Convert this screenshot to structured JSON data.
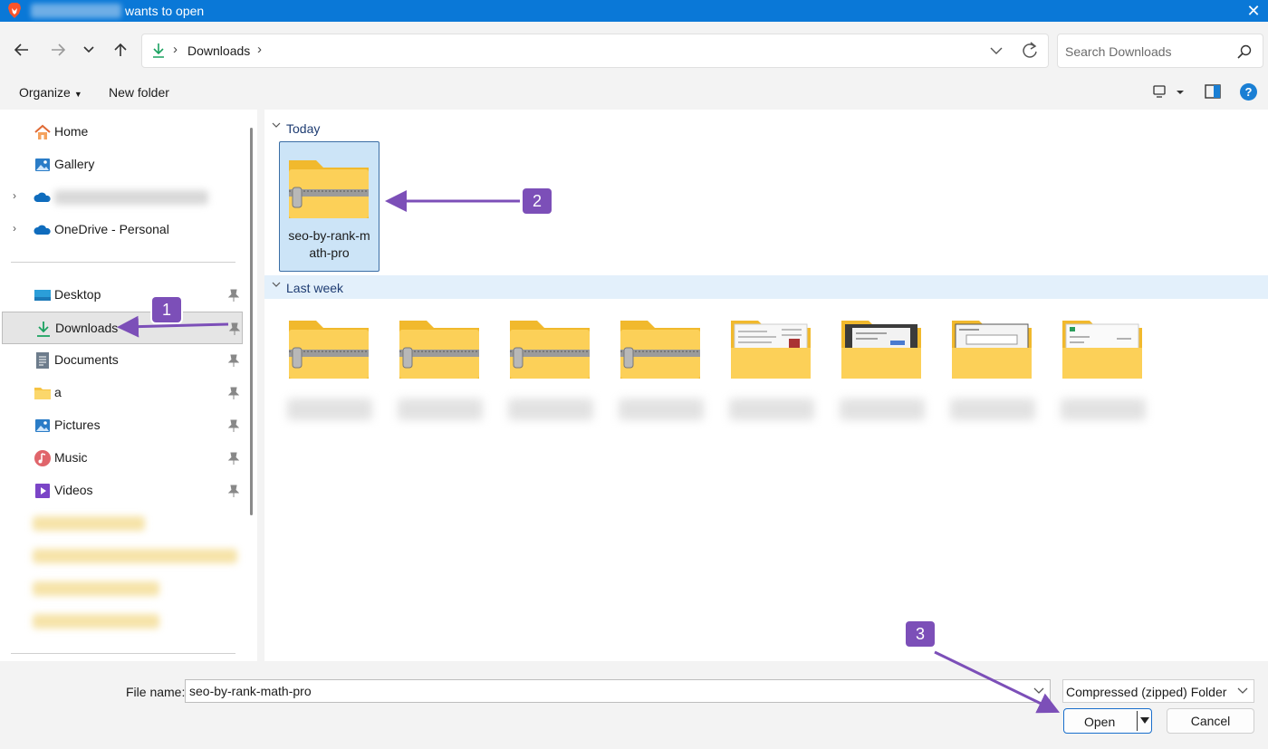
{
  "titlebar": {
    "title_suffix": "wants to open",
    "close_glyph": "✕",
    "app_icon": "brave-lion-icon"
  },
  "nav": {
    "back_icon": "back-arrow-icon",
    "forward_icon": "forward-arrow-icon",
    "recent_icon": "chevron-down-icon",
    "up_icon": "up-arrow-icon",
    "address": {
      "location": "Downloads",
      "chevron": "›"
    },
    "search_placeholder": "Search Downloads"
  },
  "commands": {
    "organize": "Organize",
    "new_folder": "New folder",
    "help": "?"
  },
  "sidebar": {
    "items": [
      {
        "label": "Home",
        "icon": "home-icon"
      },
      {
        "label": "Gallery",
        "icon": "gallery-icon"
      },
      {
        "label": "",
        "icon": "onedrive-cloud-icon",
        "blurred": true
      },
      {
        "label": "OneDrive - Personal",
        "icon": "onedrive-cloud-icon"
      },
      {
        "label": "Desktop",
        "icon": "desktop-icon"
      },
      {
        "label": "Downloads",
        "icon": "download-icon"
      },
      {
        "label": "Documents",
        "icon": "documents-icon"
      },
      {
        "label": "a",
        "icon": "folder-icon"
      },
      {
        "label": "Pictures",
        "icon": "pictures-icon"
      },
      {
        "label": "Music",
        "icon": "music-icon"
      },
      {
        "label": "Videos",
        "icon": "videos-icon"
      }
    ],
    "expand_glyph": "›"
  },
  "groups": {
    "today": {
      "label": "Today",
      "files": [
        {
          "name": "seo-by-rank-math-pro",
          "line1": "seo-by-rank-m",
          "line2": "ath-pro",
          "type": "zip"
        }
      ]
    },
    "last_week": {
      "label": "Last week",
      "files": [
        {
          "type": "zip"
        },
        {
          "type": "zip"
        },
        {
          "type": "zip"
        },
        {
          "type": "zip"
        },
        {
          "type": "folder-preview"
        },
        {
          "type": "folder-preview"
        },
        {
          "type": "folder-preview"
        },
        {
          "type": "folder-preview"
        }
      ]
    }
  },
  "annotations": {
    "badge1": "1",
    "badge2": "2",
    "badge3": "3",
    "color": "#7c4fb8"
  },
  "footer": {
    "file_name_label": "File name:",
    "file_name_value": "seo-by-rank-math-pro",
    "file_type": "Compressed (zipped) Folder",
    "open": "Open",
    "cancel": "Cancel"
  }
}
